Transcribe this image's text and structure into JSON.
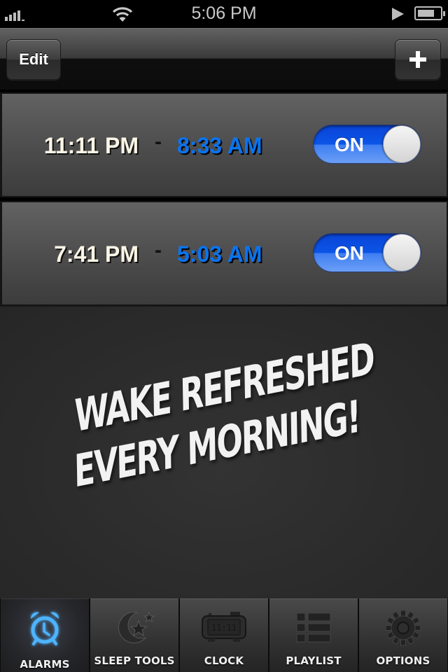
{
  "status_bar": {
    "time": "5:06 PM",
    "signal_bars": 4,
    "battery_level": 0.75,
    "icons": [
      "signal-icon",
      "wifi-icon",
      "play-icon",
      "battery-icon"
    ]
  },
  "nav_bar": {
    "edit_label": "Edit",
    "add_icon": "plus-icon"
  },
  "alarms": [
    {
      "bedtime": "11:11 PM",
      "separator": "-",
      "wake_time": "8:33 AM",
      "toggle_label": "ON",
      "enabled": true
    },
    {
      "bedtime": "7:41 PM",
      "separator": "-",
      "wake_time": "5:03 AM",
      "toggle_label": "ON",
      "enabled": true
    }
  ],
  "promo": {
    "line1": "WAKE  REFRESHED",
    "line2": "EVERY  MORNING!"
  },
  "tab_bar": {
    "active": "alarms",
    "tabs": [
      {
        "id": "alarms",
        "label": "ALARMS",
        "icon": "alarm-clock-icon"
      },
      {
        "id": "sleep-tools",
        "label": "SLEEP TOOLS",
        "icon": "moon-stars-icon"
      },
      {
        "id": "clock",
        "label": "CLOCK",
        "icon": "digital-clock-icon",
        "icon_text": "11:11"
      },
      {
        "id": "playlist",
        "label": "PLAYLIST",
        "icon": "list-icon"
      },
      {
        "id": "options",
        "label": "OPTIONS",
        "icon": "gear-icon"
      }
    ]
  },
  "colors": {
    "accent_blue": "#0a74f0",
    "toggle_blue": "#0b55e6",
    "bedtime_text": "#fbf5e6",
    "alarm_icon_glow": "#3fa9ff"
  }
}
